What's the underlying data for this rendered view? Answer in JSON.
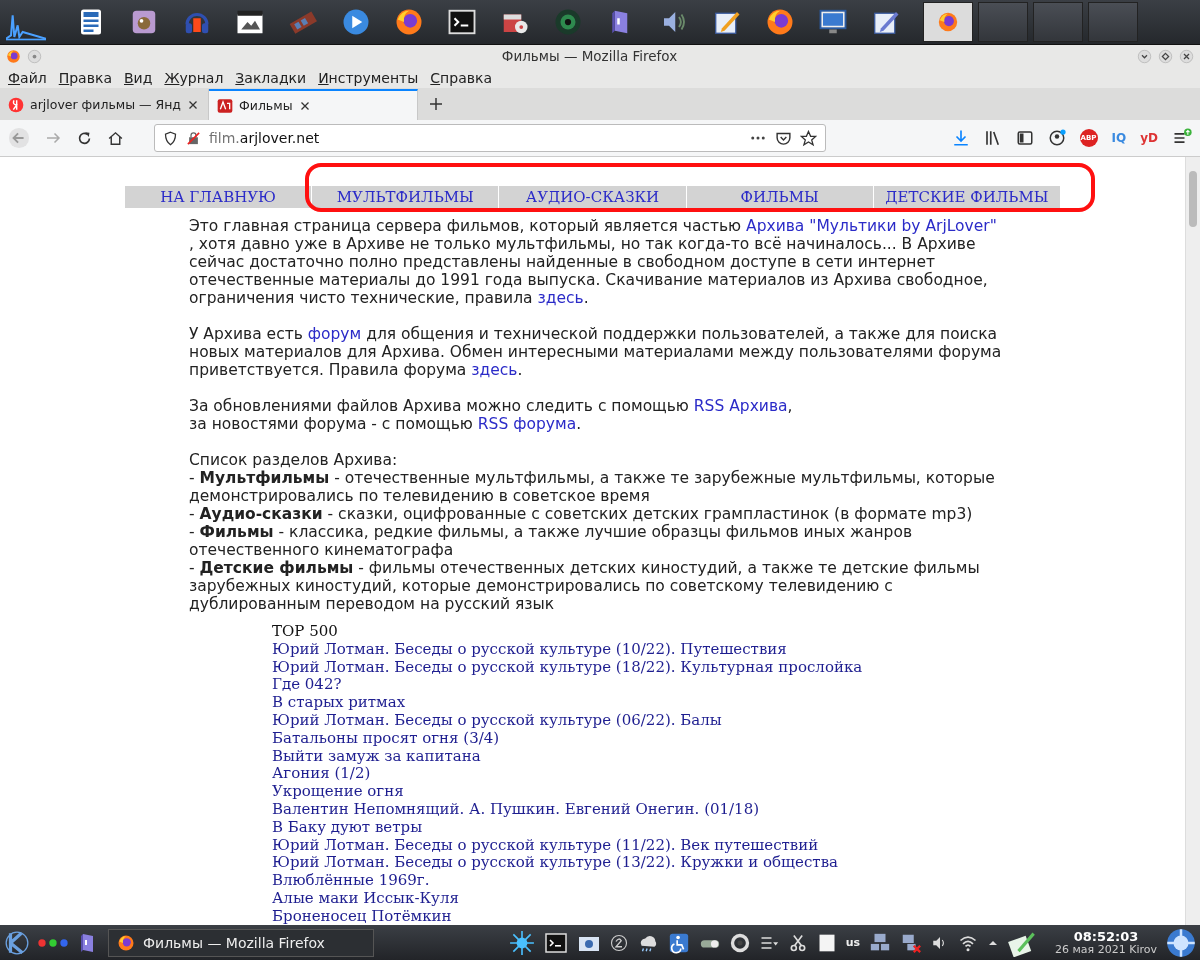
{
  "window": {
    "title": "Фильмы — Mozilla Firefox"
  },
  "menu": [
    "Файл",
    "Правка",
    "Вид",
    "Журнал",
    "Закладки",
    "Инструменты",
    "Справка"
  ],
  "tabs": [
    {
      "label": "arjlover фильмы — Янд",
      "selected": false
    },
    {
      "label": "Фильмы",
      "selected": true
    }
  ],
  "address": {
    "prefix": "film.",
    "domain": "arjlover.net"
  },
  "toolbar_badges": [
    "ABP",
    "IQ",
    "yD"
  ],
  "site_nav": [
    "НА ГЛАВНУЮ",
    "МУЛЬТФИЛЬМЫ",
    "АУДИО-СКАЗКИ",
    "ФИЛЬМЫ",
    "ДЕТСКИЕ ФИЛЬМЫ"
  ],
  "paragraphs": [
    [
      [
        {
          "text": "Это главная страница сервера фильмов, который является частью ",
          "kind": "text"
        },
        {
          "text": "Архива \"Мультики by ArjLover\"",
          "kind": "link"
        }
      ],
      [
        {
          "text": ", хотя давно уже в Архиве не только мультфильмы, но так когда-то всё начиналось... В Архиве",
          "kind": "text"
        }
      ],
      [
        {
          "text": "сейчас достаточно полно представлены найденные в свободном доступе в сети интернет",
          "kind": "text"
        }
      ],
      [
        {
          "text": "отечественные материалы до 1991 года выпуска. Скачивание материалов из Архива свободное,",
          "kind": "text"
        }
      ],
      [
        {
          "text": "ограничения чисто технические, правила ",
          "kind": "text"
        },
        {
          "text": "здесь",
          "kind": "link"
        },
        {
          "text": ".",
          "kind": "text"
        }
      ]
    ],
    [
      [
        {
          "text": "У Архива есть ",
          "kind": "text"
        },
        {
          "text": "форум",
          "kind": "link"
        },
        {
          "text": " для общения и технической поддержки пользователей, а также для поиска",
          "kind": "text"
        }
      ],
      [
        {
          "text": "новых материалов для Архива. Обмен интересными материалами между пользователями форума",
          "kind": "text"
        }
      ],
      [
        {
          "text": "приветствуется. Правила форума ",
          "kind": "text"
        },
        {
          "text": "здесь",
          "kind": "link"
        },
        {
          "text": ".",
          "kind": "text"
        }
      ]
    ],
    [
      [
        {
          "text": "За обновлениями файлов Архива можно следить с помощью ",
          "kind": "text"
        },
        {
          "text": "RSS Архива",
          "kind": "link"
        },
        {
          "text": ",",
          "kind": "text"
        }
      ],
      [
        {
          "text": "за новостями форума - с помощью ",
          "kind": "text"
        },
        {
          "text": "RSS форума",
          "kind": "link"
        },
        {
          "text": ".",
          "kind": "text"
        }
      ]
    ],
    [
      [
        {
          "text": "Список разделов Архива:",
          "kind": "text"
        }
      ],
      [
        {
          "text": "- ",
          "kind": "text"
        },
        {
          "text": "Мультфильмы",
          "kind": "bold"
        },
        {
          "text": " - отечественные мультфильмы, а также те зарубежные мультфильмы, которые",
          "kind": "text"
        }
      ],
      [
        {
          "text": "демонстрировались по телевидению в советское время",
          "kind": "text"
        }
      ],
      [
        {
          "text": "- ",
          "kind": "text"
        },
        {
          "text": "Аудио-сказки",
          "kind": "bold"
        },
        {
          "text": " - сказки, оцифрованные с советских детских грампластинок (в формате mp3)",
          "kind": "text"
        }
      ],
      [
        {
          "text": "- ",
          "kind": "text"
        },
        {
          "text": "Фильмы",
          "kind": "bold"
        },
        {
          "text": " - классика, редкие фильмы, а также лучшие образцы фильмов иных жанров",
          "kind": "text"
        }
      ],
      [
        {
          "text": "отечественного кинематографа",
          "kind": "text"
        }
      ],
      [
        {
          "text": "- ",
          "kind": "text"
        },
        {
          "text": "Детские фильмы",
          "kind": "bold"
        },
        {
          "text": " - фильмы отечественных детских киностудий, а также те детские фильмы",
          "kind": "text"
        }
      ],
      [
        {
          "text": "зарубежных киностудий, которые демонстрировались по советскому телевидению с",
          "kind": "text"
        }
      ],
      [
        {
          "text": "дублированным переводом на русский язык",
          "kind": "text"
        }
      ]
    ]
  ],
  "top_list": {
    "title": "TOP 500",
    "items": [
      "Юрий Лотман. Беседы о русской культуре (10/22). Путешествия",
      "Юрий Лотман. Беседы о русской культуре (18/22). Культурная прослойка",
      "Где 042?",
      "В старых ритмах",
      "Юрий Лотман. Беседы о русской культуре (06/22). Балы",
      "Батальоны просят огня (3/4)",
      "Выйти замуж за капитана",
      "Агония (1/2)",
      "Укрощение огня",
      "Валентин Непомнящий. А. Пушкин. Евгений Онегин. (01/18)",
      "В Баку дуют ветры",
      "Юрий Лотман. Беседы о русской культуре (11/22). Век путешествий",
      "Юрий Лотман. Беседы о русской культуре (13/22). Кружки и общества",
      "Влюблённые 1969г.",
      "Алые маки Иссык-Куля",
      "Броненосец Потёмкин"
    ]
  },
  "taskbar": {
    "task": "Фильмы — Mozilla Firefox",
    "keyboard": "us",
    "time": "08:52:03",
    "date": "26 мая 2021 Kirov"
  }
}
